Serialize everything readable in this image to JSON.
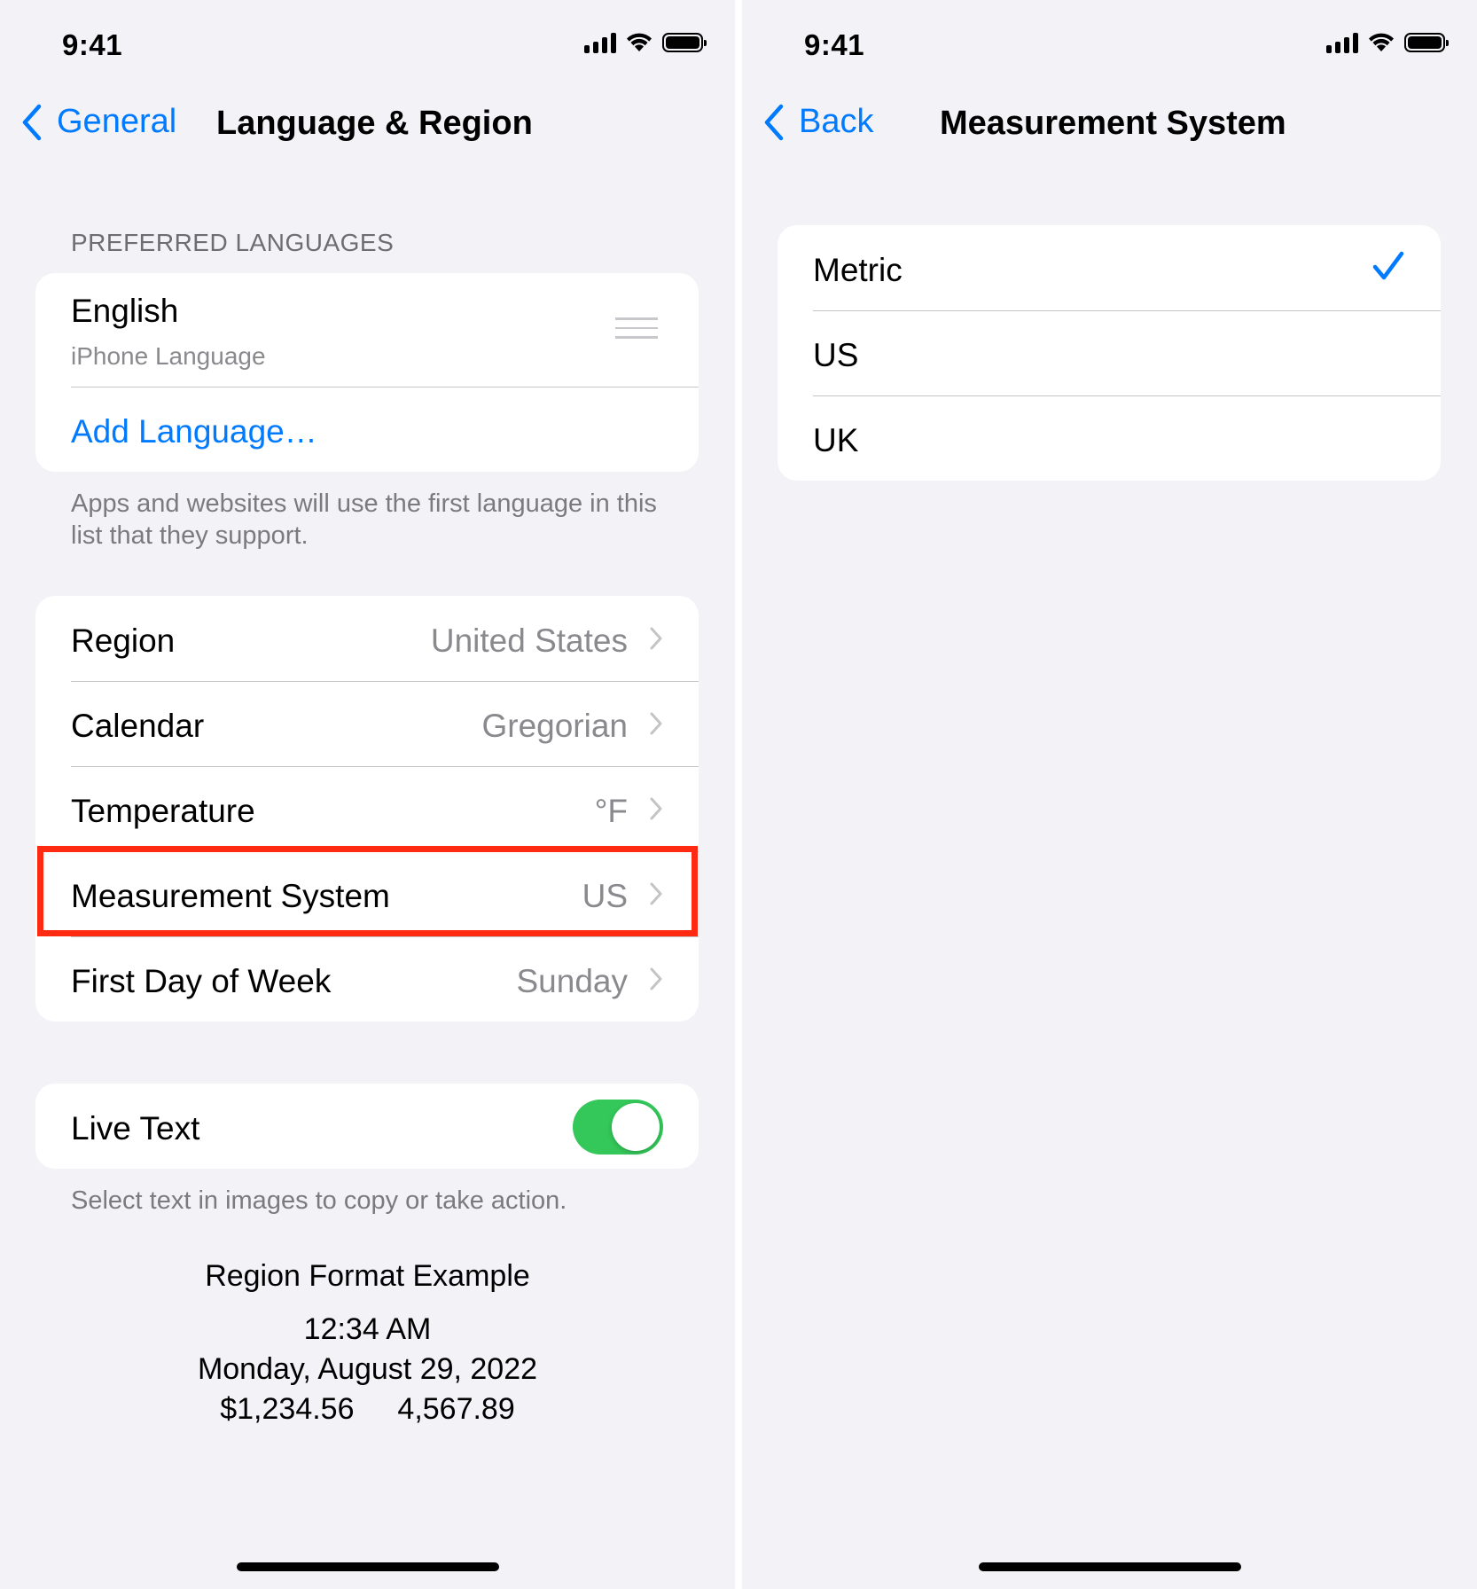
{
  "left": {
    "status": {
      "time": "9:41"
    },
    "nav": {
      "back_label": "General",
      "title": "Language & Region"
    },
    "preferred_languages": {
      "header": "PREFERRED LANGUAGES",
      "language": {
        "name": "English",
        "subtitle": "iPhone Language"
      },
      "add_label": "Add Language…",
      "footer": "Apps and websites will use the first language in this list that they support."
    },
    "settings": [
      {
        "label": "Region",
        "value": "United States"
      },
      {
        "label": "Calendar",
        "value": "Gregorian"
      },
      {
        "label": "Temperature",
        "value": "°F"
      },
      {
        "label": "Measurement System",
        "value": "US"
      },
      {
        "label": "First Day of Week",
        "value": "Sunday"
      }
    ],
    "live_text": {
      "label": "Live Text",
      "enabled": true,
      "footer": "Select text in images to copy or take action."
    },
    "example": {
      "title": "Region Format Example",
      "time": "12:34 AM",
      "date": "Monday, August 29, 2022",
      "currency": "$1,234.56",
      "number": "4,567.89"
    }
  },
  "right": {
    "status": {
      "time": "9:41"
    },
    "nav": {
      "back_label": "Back",
      "title": "Measurement System"
    },
    "options": [
      {
        "label": "Metric",
        "selected": true
      },
      {
        "label": "US",
        "selected": false
      },
      {
        "label": "UK",
        "selected": false
      }
    ]
  },
  "colors": {
    "accent": "#007aff",
    "toggle_on": "#34c759",
    "highlight": "#ff2a12",
    "background": "#f2f2f7"
  }
}
